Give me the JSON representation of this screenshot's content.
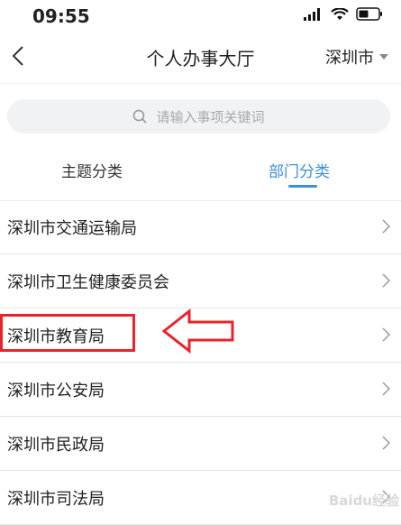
{
  "status_bar": {
    "time": "09:55"
  },
  "header": {
    "title": "个人办事大厅",
    "city": "深圳市"
  },
  "search": {
    "placeholder": "请输入事项关键词"
  },
  "tabs": [
    {
      "label": "主题分类",
      "active": false
    },
    {
      "label": "部门分类",
      "active": true
    }
  ],
  "list": [
    {
      "label": "深圳市交通运输局"
    },
    {
      "label": "深圳市卫生健康委员会"
    },
    {
      "label": "深圳市教育局",
      "highlighted": true
    },
    {
      "label": "深圳市公安局"
    },
    {
      "label": "深圳市民政局"
    },
    {
      "label": "深圳市司法局"
    }
  ],
  "watermark": "Baidu经验",
  "colors": {
    "accent": "#3d8fdc",
    "annotation": "#e8242a"
  }
}
